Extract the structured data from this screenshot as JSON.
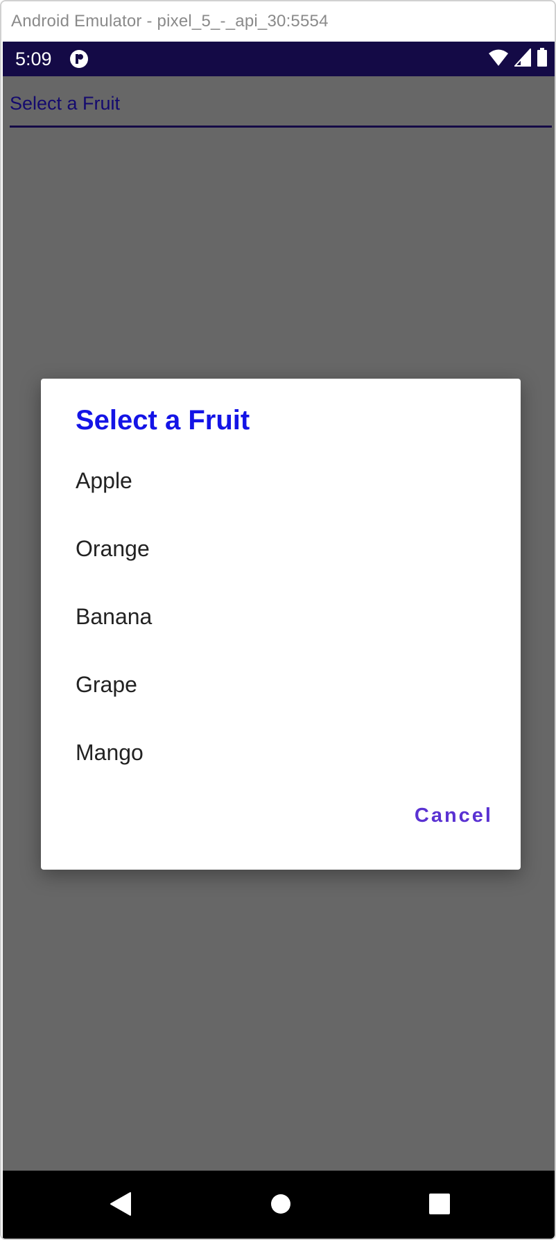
{
  "window": {
    "title": "Android Emulator - pixel_5_-_api_30:5554"
  },
  "statusbar": {
    "time": "5:09",
    "app_icon": "app-notification-icon",
    "icons": [
      "wifi-icon",
      "cellular-signal-icon",
      "battery-icon"
    ]
  },
  "picker": {
    "label": "Select a Fruit"
  },
  "dialog": {
    "title": "Select a Fruit",
    "items": [
      {
        "label": "Apple"
      },
      {
        "label": "Orange"
      },
      {
        "label": "Banana"
      },
      {
        "label": "Grape"
      },
      {
        "label": "Mango"
      }
    ],
    "cancel_label": "Cancel"
  },
  "navbar": {
    "icons": [
      "back-icon",
      "home-icon",
      "recents-icon"
    ]
  },
  "colors": {
    "status_bar": "#140a46",
    "scrim": "#676767",
    "dialog_title": "#1414e6",
    "cancel_button": "#5a32d2",
    "picker_text": "#140a6e"
  }
}
